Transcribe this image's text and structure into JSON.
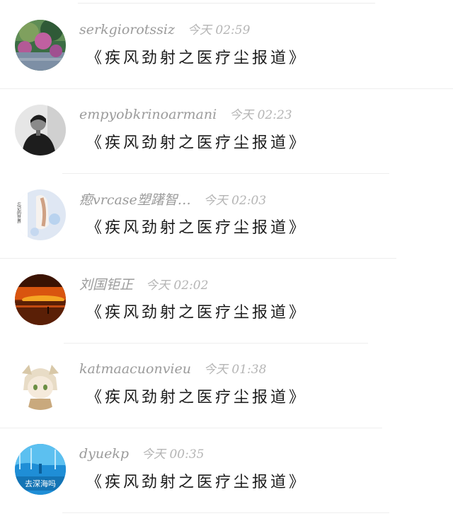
{
  "comments": [
    {
      "username": "serkgiorotssiz",
      "time": "今天 02:59",
      "message": "《疾风劲射之医疗尘报道》",
      "avatar": {
        "icon": "nature-avatar",
        "colors": [
          "#2f5a37",
          "#7fa05e",
          "#c060a0",
          "#3b6d44"
        ]
      }
    },
    {
      "username": "empyobkrinoarmani",
      "time": "今天 02:23",
      "message": "《疾风劲射之医疗尘报道》",
      "avatar": {
        "icon": "person-avatar",
        "colors": [
          "#e6e6e6",
          "#1d1d1d",
          "#555555"
        ]
      }
    },
    {
      "username": "瘛vrcase塑躇智…",
      "time": "今天 02:03",
      "message": "《疾风劲射之医疗尘报道》",
      "avatar": {
        "icon": "illustration-avatar",
        "colors": [
          "#dfe7f3",
          "#cfa184",
          "#ffffff"
        ],
        "caption": "忘记的世界"
      }
    },
    {
      "username": "刘国钜正",
      "time": "今天 02:02",
      "message": "《疾风劲射之医疗尘报道》",
      "avatar": {
        "icon": "sunset-avatar",
        "colors": [
          "#3b1303",
          "#d9550f",
          "#f5a623",
          "#7a2a08"
        ]
      }
    },
    {
      "username": "katmaacuonvieu",
      "time": "今天 01:38",
      "message": "《疾风劲射之医疗尘报道》",
      "avatar": {
        "icon": "anime-avatar",
        "colors": [
          "#ffffff",
          "#e8dcc6",
          "#c9a97d",
          "#6b8f44"
        ]
      }
    },
    {
      "username": "dyuekp",
      "time": "今天 00:35",
      "message": "《疾风劲射之医疗尘报道》",
      "avatar": {
        "icon": "ocean-avatar",
        "colors": [
          "#1f8ed6",
          "#5cc0f0",
          "#0b5f9a"
        ],
        "caption": "去深海吗"
      }
    }
  ],
  "colors": {
    "background": "#ffffff",
    "username": "#9b9b9b",
    "time": "#b5b5b5",
    "message": "#1c1c1c",
    "divider": "#eeeeee"
  }
}
